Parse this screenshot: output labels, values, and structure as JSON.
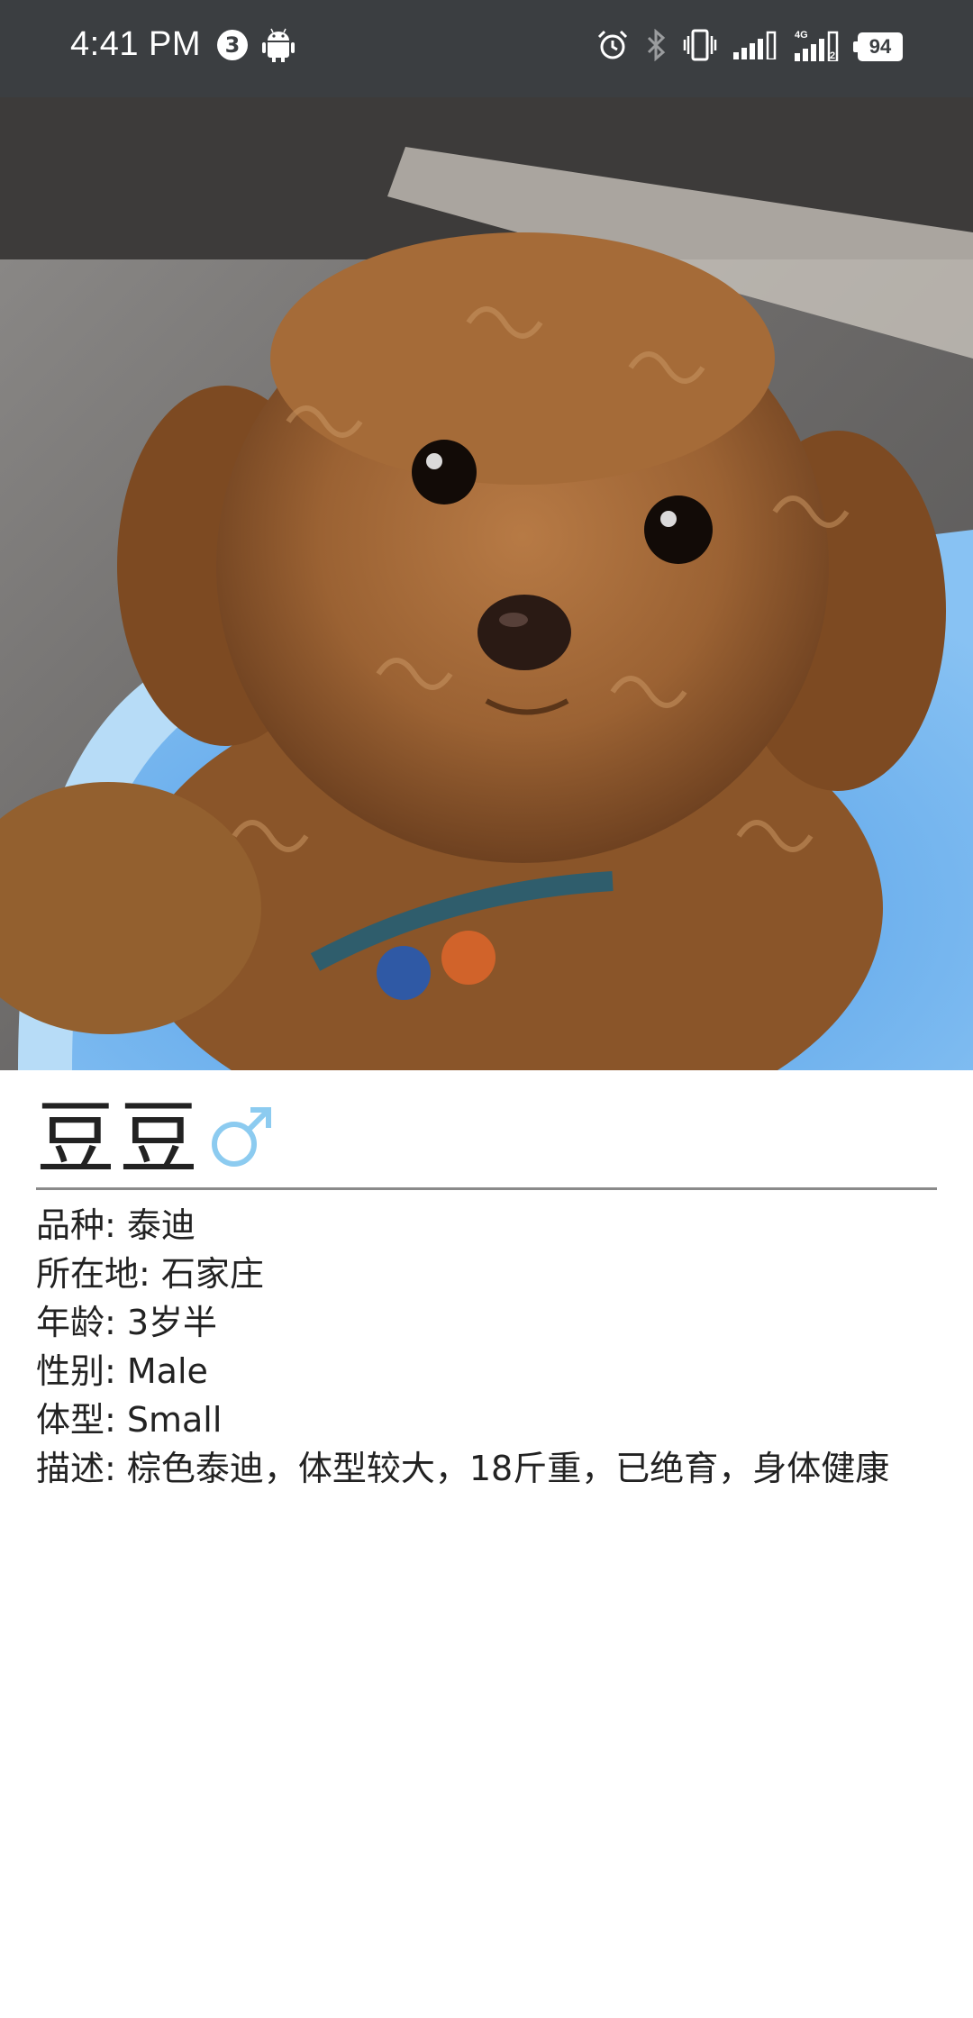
{
  "status_bar": {
    "time": "4:41 PM",
    "notification_count": "3",
    "network_label": "4G",
    "battery": "94",
    "icons": [
      "alarm-icon",
      "bluetooth-icon",
      "vibrate-icon",
      "signal-icon",
      "signal-4g-icon",
      "battery-icon"
    ]
  },
  "photo": {
    "icon": "poodle-photo"
  },
  "pet": {
    "name": "豆豆",
    "gender_symbol": "male",
    "gender_color": "#8ccbf0",
    "details": [
      "品种: 泰迪",
      "所在地: 石家庄",
      "年龄: 3岁半",
      "性别: Male",
      "体型: Small",
      "描述: 棕色泰迪，体型较大，18斤重，已绝育，身体健康"
    ]
  }
}
